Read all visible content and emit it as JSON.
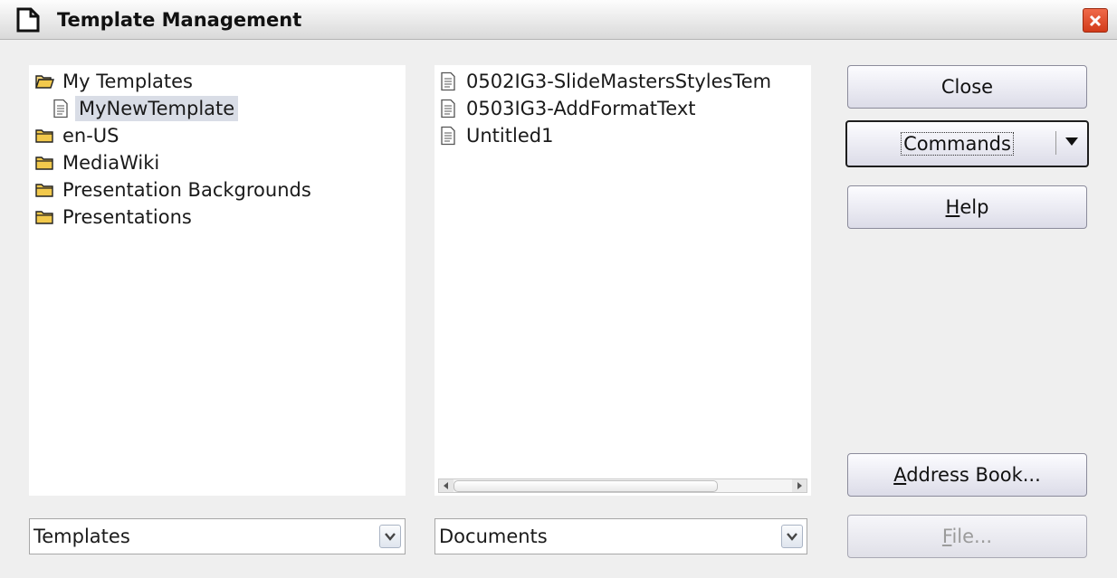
{
  "window": {
    "title": "Template Management"
  },
  "tree": {
    "items": [
      {
        "label": "My Templates",
        "icon": "folder-open-icon",
        "indent": 0,
        "selected": false
      },
      {
        "label": "MyNewTemplate",
        "icon": "document-icon",
        "indent": 1,
        "selected": true
      },
      {
        "label": "en-US",
        "icon": "folder-icon",
        "indent": 0,
        "selected": false
      },
      {
        "label": "MediaWiki",
        "icon": "folder-icon",
        "indent": 0,
        "selected": false
      },
      {
        "label": "Presentation Backgrounds",
        "icon": "folder-icon",
        "indent": 0,
        "selected": false
      },
      {
        "label": "Presentations",
        "icon": "folder-icon",
        "indent": 0,
        "selected": false
      }
    ]
  },
  "documents": {
    "items": [
      {
        "label": "0502IG3-SlideMastersStylesTem",
        "icon": "document-icon"
      },
      {
        "label": "0503IG3-AddFormatText",
        "icon": "document-icon"
      },
      {
        "label": "Untitled1",
        "icon": "document-icon"
      }
    ]
  },
  "left_combo": {
    "value": "Templates"
  },
  "right_combo": {
    "value": "Documents"
  },
  "buttons": {
    "close": "Close",
    "commands": "Commands",
    "help_mnemonic": "H",
    "help_rest": "elp",
    "address_mnemonic": "A",
    "address_rest": "ddress Book...",
    "file_mnemonic": "F",
    "file_rest": "ile..."
  },
  "colors": {
    "selection": "#d9dde6",
    "close_button": "#e0401c",
    "folder": "#f2c94c"
  }
}
